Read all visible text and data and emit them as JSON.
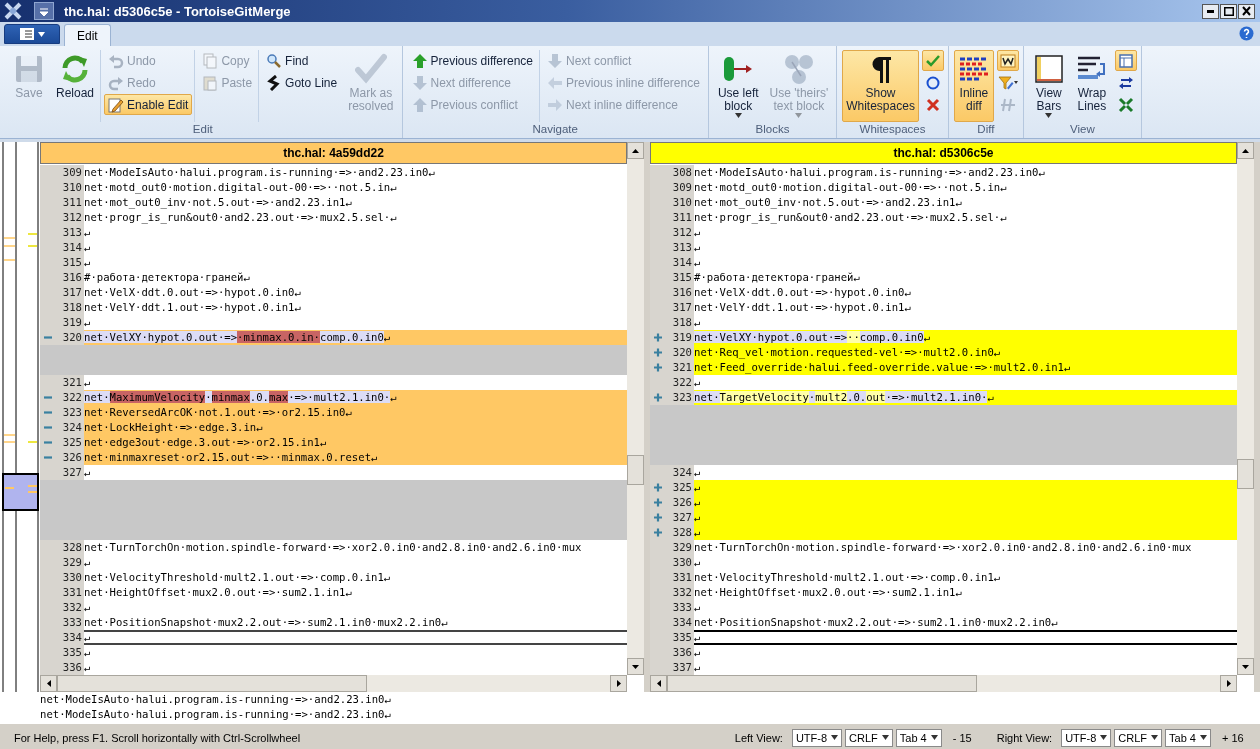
{
  "window": {
    "title": "thc.hal: d5306c5e - TortoiseGitMerge"
  },
  "tabs": [
    {
      "label": "Edit",
      "selected": true
    }
  ],
  "ribbon": {
    "groups": [
      {
        "label": "Edit",
        "columns": [
          [
            {
              "kind": "large",
              "label": "Save",
              "disabled": true,
              "checked": false
            }
          ],
          [
            {
              "kind": "large",
              "label": "Reload",
              "disabled": false,
              "checked": false
            }
          ],
          [
            {
              "kind": "small",
              "label": "Undo",
              "disabled": true,
              "checked": false
            },
            {
              "kind": "small",
              "label": "Redo",
              "disabled": true,
              "checked": false
            },
            {
              "kind": "small",
              "label": "Enable Edit",
              "disabled": false,
              "checked": true
            }
          ],
          [
            {
              "kind": "small",
              "label": "Copy",
              "disabled": true,
              "checked": false
            },
            {
              "kind": "small",
              "label": "Paste",
              "disabled": true,
              "checked": false
            }
          ],
          [
            {
              "kind": "small",
              "label": "Find",
              "disabled": false,
              "checked": false
            },
            {
              "kind": "small",
              "label": "Goto Line",
              "disabled": false,
              "checked": false
            }
          ],
          [
            {
              "kind": "large",
              "label": "Mark as\nresolved",
              "disabled": true,
              "checked": false
            }
          ]
        ]
      },
      {
        "label": "Navigate",
        "columns": [
          [
            {
              "kind": "small",
              "label": "Previous difference",
              "disabled": false,
              "checked": false
            },
            {
              "kind": "small",
              "label": "Next difference",
              "disabled": true,
              "checked": false
            },
            {
              "kind": "small",
              "label": "Previous conflict",
              "disabled": true,
              "checked": false
            }
          ],
          [
            {
              "kind": "small",
              "label": "Next conflict",
              "disabled": true,
              "checked": false
            },
            {
              "kind": "small",
              "label": "Previous inline difference",
              "disabled": true,
              "checked": false
            },
            {
              "kind": "small",
              "label": "Next inline difference",
              "disabled": true,
              "checked": false
            }
          ]
        ]
      },
      {
        "label": "Blocks",
        "columns": [
          [
            {
              "kind": "large",
              "label": "Use left\nblock",
              "disabled": false,
              "checked": false,
              "dropdown": true
            }
          ],
          [
            {
              "kind": "large",
              "label": "Use 'theirs'\ntext block",
              "disabled": true,
              "checked": false,
              "dropdown": true
            }
          ]
        ]
      },
      {
        "label": "Whitespaces",
        "columns": [
          [
            {
              "kind": "large",
              "label": "Show\nWhitespaces",
              "disabled": false,
              "checked": true
            }
          ],
          [
            {
              "kind": "icon",
              "disabled": false,
              "checked": true
            },
            {
              "kind": "icon",
              "disabled": false
            },
            {
              "kind": "icon",
              "disabled": false
            }
          ]
        ]
      },
      {
        "label": "Diff",
        "columns": [
          [
            {
              "kind": "large",
              "label": "Inline\ndiff",
              "disabled": false,
              "checked": true
            }
          ],
          [
            {
              "kind": "icon",
              "disabled": false,
              "checked": true
            },
            {
              "kind": "icon",
              "disabled": false,
              "dropdown": true
            },
            {
              "kind": "icon",
              "disabled": true,
              "checked": false
            }
          ]
        ]
      },
      {
        "label": "View",
        "columns": [
          [
            {
              "kind": "large",
              "label": "View\nBars",
              "disabled": false,
              "checked": false,
              "dropdown": true
            }
          ],
          [
            {
              "kind": "large",
              "label": "Wrap\nLines",
              "disabled": false,
              "checked": false
            }
          ],
          [
            {
              "kind": "icon",
              "disabled": false,
              "checked": true
            },
            {
              "kind": "icon",
              "disabled": false
            },
            {
              "kind": "icon",
              "disabled": false
            }
          ]
        ]
      }
    ]
  },
  "panes": [
    {
      "title": "thc.hal: 4a59dd22",
      "lines": [
        {
          "number": "309",
          "kind": "normal",
          "current": false,
          "text": "net·ModeIsAuto·halui.program.is-running·=>·and2.23.in0↵"
        },
        {
          "number": "310",
          "kind": "normal",
          "current": false,
          "text": "net·motd_out0·motion.digital-out-00·=>··not.5.in↵"
        },
        {
          "number": "311",
          "kind": "normal",
          "current": false,
          "text": "net·mot_out0_inv·not.5.out·=>·and2.23.in1↵"
        },
        {
          "number": "312",
          "kind": "normal",
          "current": false,
          "text": "net·progr_is_run&out0·and2.23.out·=>·mux2.5.sel·↵"
        },
        {
          "number": "313",
          "kind": "normal",
          "current": false,
          "text": "↵"
        },
        {
          "number": "314",
          "kind": "normal",
          "current": false,
          "text": "↵"
        },
        {
          "number": "315",
          "kind": "normal",
          "current": false,
          "text": "↵"
        },
        {
          "number": "316",
          "kind": "normal",
          "current": false,
          "text": "#·работа·детектора·граней↵"
        },
        {
          "number": "317",
          "kind": "normal",
          "current": false,
          "text": "net·VelX·ddt.0.out·=>·hypot.0.in0↵"
        },
        {
          "number": "318",
          "kind": "normal",
          "current": false,
          "text": "net·VelY·ddt.1.out·=>·hypot.0.in1↵"
        },
        {
          "number": "319",
          "kind": "normal",
          "current": false,
          "text": "↵"
        },
        {
          "number": "320",
          "kind": "removed",
          "current": false,
          "segments": [
            {
              "text": "net·VelXY·hypot.0.out·=>",
              "changed": false
            },
            {
              "text": "·minmax.0.in·",
              "changed": true
            },
            {
              "text": "comp.0.in0",
              "changed": false
            }
          ],
          "text": "↵"
        },
        {
          "kind": "filler"
        },
        {
          "kind": "filler"
        },
        {
          "number": "321",
          "kind": "normal",
          "current": false,
          "text": "↵"
        },
        {
          "number": "322",
          "kind": "removed",
          "current": false,
          "segments": [
            {
              "text": "net·",
              "changed": false
            },
            {
              "text": "MaximumVelocity",
              "changed": true
            },
            {
              "text": "·",
              "changed": false
            },
            {
              "text": "minmax",
              "changed": true
            },
            {
              "text": ".0.",
              "changed": false
            },
            {
              "text": "max",
              "changed": true
            },
            {
              "text": "·=>·mult2.1.in0·",
              "changed": false
            }
          ],
          "text": "↵"
        },
        {
          "number": "323",
          "kind": "removed",
          "current": false,
          "text": "net·ReversedArcOK·not.1.out·=>·or2.15.in0↵"
        },
        {
          "number": "324",
          "kind": "removed",
          "current": false,
          "text": "net·LockHeight·=>·edge.3.in↵"
        },
        {
          "number": "325",
          "kind": "removed",
          "current": false,
          "text": "net·edge3out·edge.3.out·=>·or2.15.in1↵"
        },
        {
          "number": "326",
          "kind": "removed",
          "current": false,
          "text": "net·minmaxreset·or2.15.out·=>··minmax.0.reset↵"
        },
        {
          "number": "327",
          "kind": "normal",
          "current": false,
          "text": "↵"
        },
        {
          "kind": "filler"
        },
        {
          "kind": "filler"
        },
        {
          "kind": "filler"
        },
        {
          "kind": "filler"
        },
        {
          "number": "328",
          "kind": "normal",
          "current": false,
          "text": "net·TurnTorchOn·motion.spindle-forward·=>·xor2.0.in0·and2.8.in0·and2.6.in0·mux"
        },
        {
          "number": "329",
          "kind": "normal",
          "current": false,
          "text": "↵"
        },
        {
          "number": "330",
          "kind": "normal",
          "current": false,
          "text": "net·VelocityThreshold·mult2.1.out·=>·comp.0.in1↵"
        },
        {
          "number": "331",
          "kind": "normal",
          "current": false,
          "text": "net·HeightOffset·mux2.0.out·=>·sum2.1.in1↵"
        },
        {
          "number": "332",
          "kind": "normal",
          "current": false,
          "text": "↵"
        },
        {
          "number": "333",
          "kind": "normal",
          "current": false,
          "text": "net·PositionSnapshot·mux2.2.out·=>·sum2.1.in0·mux2.2.in0↵"
        },
        {
          "number": "334",
          "kind": "normal",
          "current": true,
          "text": "↵"
        },
        {
          "number": "335",
          "kind": "normal",
          "current": false,
          "text": "↵"
        },
        {
          "number": "336",
          "kind": "normal",
          "current": false,
          "text": "↵"
        }
      ]
    },
    {
      "title": "thc.hal: d5306c5e",
      "lines": [
        {
          "number": "308",
          "kind": "normal",
          "current": false,
          "text": "net·ModeIsAuto·halui.program.is-running·=>·and2.23.in0↵"
        },
        {
          "number": "309",
          "kind": "normal",
          "current": false,
          "text": "net·motd_out0·motion.digital-out-00·=>··not.5.in↵"
        },
        {
          "number": "310",
          "kind": "normal",
          "current": false,
          "text": "net·mot_out0_inv·not.5.out·=>·and2.23.in1↵"
        },
        {
          "number": "311",
          "kind": "normal",
          "current": false,
          "text": "net·progr_is_run&out0·and2.23.out·=>·mux2.5.sel·↵"
        },
        {
          "number": "312",
          "kind": "normal",
          "current": false,
          "text": "↵"
        },
        {
          "number": "313",
          "kind": "normal",
          "current": false,
          "text": "↵"
        },
        {
          "number": "314",
          "kind": "normal",
          "current": false,
          "text": "↵"
        },
        {
          "number": "315",
          "kind": "normal",
          "current": false,
          "text": "#·работа·детектора·граней↵"
        },
        {
          "number": "316",
          "kind": "normal",
          "current": false,
          "text": "net·VelX·ddt.0.out·=>·hypot.0.in0↵"
        },
        {
          "number": "317",
          "kind": "normal",
          "current": false,
          "text": "net·VelY·ddt.1.out·=>·hypot.0.in1↵"
        },
        {
          "number": "318",
          "kind": "normal",
          "current": false,
          "text": "↵"
        },
        {
          "number": "319",
          "kind": "added",
          "current": false,
          "segments": [
            {
              "text": "net·VelXY·hypot.0.out·=>",
              "changed": false
            },
            {
              "text": "··",
              "changed": true
            },
            {
              "text": "comp.0.in0",
              "changed": false
            }
          ],
          "text": "↵"
        },
        {
          "number": "320",
          "kind": "added",
          "current": false,
          "text": "net·Req_vel·motion.requested-vel·=>·mult2.0.in0↵"
        },
        {
          "number": "321",
          "kind": "added",
          "current": false,
          "text": "net·Feed_override·halui.feed-override.value·=>·mult2.0.in1↵"
        },
        {
          "number": "322",
          "kind": "normal",
          "current": false,
          "text": "↵"
        },
        {
          "number": "323",
          "kind": "added",
          "current": false,
          "segments": [
            {
              "text": "net·",
              "changed": false
            },
            {
              "text": "TargetVelocity",
              "changed": true
            },
            {
              "text": "·",
              "changed": false
            },
            {
              "text": "mult2",
              "changed": true
            },
            {
              "text": ".0.",
              "changed": false
            },
            {
              "text": "out",
              "changed": true
            },
            {
              "text": "·=>·mult2.1.in0·",
              "changed": false
            }
          ],
          "text": "↵"
        },
        {
          "kind": "filler"
        },
        {
          "kind": "filler"
        },
        {
          "kind": "filler"
        },
        {
          "kind": "filler"
        },
        {
          "number": "324",
          "kind": "normal",
          "current": false,
          "text": "↵"
        },
        {
          "number": "325",
          "kind": "added",
          "current": false,
          "text": "↵"
        },
        {
          "number": "326",
          "kind": "added",
          "current": false,
          "text": "↵"
        },
        {
          "number": "327",
          "kind": "added",
          "current": false,
          "text": "↵"
        },
        {
          "number": "328",
          "kind": "added",
          "current": false,
          "text": "↵"
        },
        {
          "number": "329",
          "kind": "normal",
          "current": false,
          "text": "net·TurnTorchOn·motion.spindle-forward·=>·xor2.0.in0·and2.8.in0·and2.6.in0·mux"
        },
        {
          "number": "330",
          "kind": "normal",
          "current": false,
          "text": "↵"
        },
        {
          "number": "331",
          "kind": "normal",
          "current": false,
          "text": "net·VelocityThreshold·mult2.1.out·=>·comp.0.in1↵"
        },
        {
          "number": "332",
          "kind": "normal",
          "current": false,
          "text": "net·HeightOffset·mux2.0.out·=>·sum2.1.in1↵"
        },
        {
          "number": "333",
          "kind": "normal",
          "current": false,
          "text": "↵"
        },
        {
          "number": "334",
          "kind": "normal",
          "current": false,
          "text": "net·PositionSnapshot·mux2.2.out·=>·sum2.1.in0·mux2.2.in0↵"
        },
        {
          "number": "335",
          "kind": "normal",
          "current": true,
          "text": "↵"
        },
        {
          "number": "336",
          "kind": "normal",
          "current": false,
          "text": "↵"
        },
        {
          "number": "337",
          "kind": "normal",
          "current": false,
          "text": "↵"
        }
      ]
    }
  ],
  "line_view": {
    "lines": [
      "net·ModeIsAuto·halui.program.is-running·=>·and2.23.in0↵",
      "net·ModeIsAuto·halui.program.is-running·=>·and2.23.in0↵"
    ]
  },
  "status_bar": {
    "help": "For Help, press F1. Scroll horizontally with Ctrl-Scrollwheel",
    "views": [
      {
        "label": "Left View:",
        "encoding": "UTF-8",
        "line_ending": "CRLF",
        "tab_size": "Tab 4",
        "offset": "- 15"
      },
      {
        "label": "Right View:",
        "encoding": "UTF-8",
        "line_ending": "CRLF",
        "tab_size": "Tab 4",
        "offset": "+ 16"
      }
    ]
  }
}
